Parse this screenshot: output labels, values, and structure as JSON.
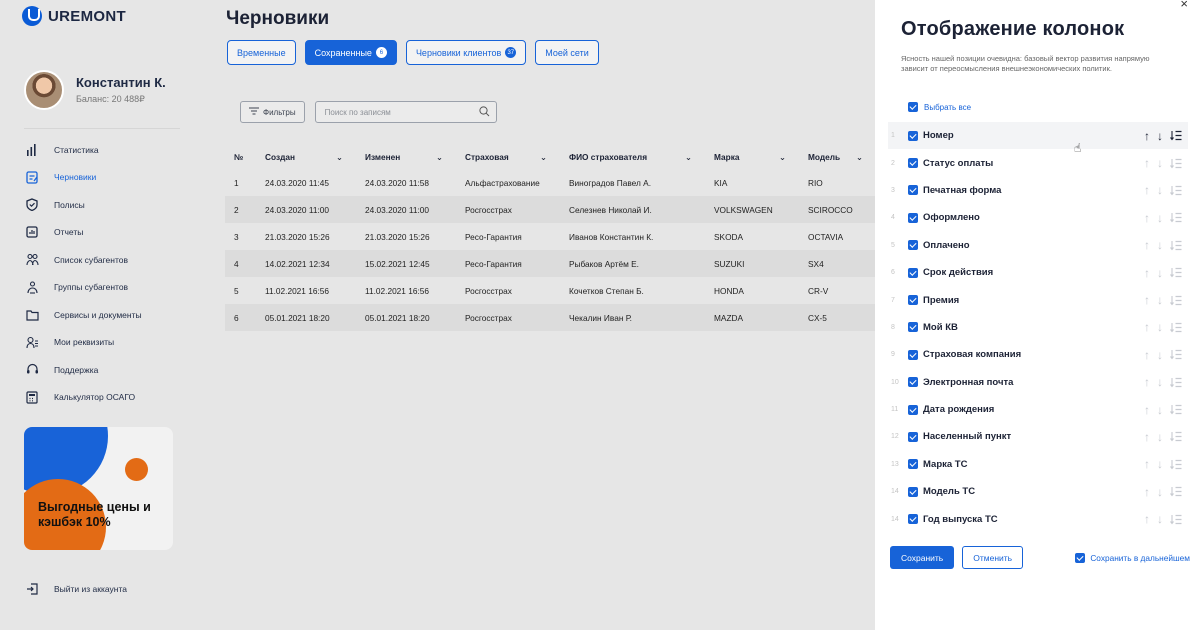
{
  "brand": {
    "name": "UREMONT"
  },
  "profile": {
    "name": "Константин К.",
    "balance": "Баланс: 20 488₽"
  },
  "nav": [
    {
      "label": "Статистика",
      "icon": "bar-chart-icon"
    },
    {
      "label": "Черновики",
      "icon": "draft-icon",
      "active": true
    },
    {
      "label": "Полисы",
      "icon": "shield-icon"
    },
    {
      "label": "Отчеты",
      "icon": "report-icon"
    },
    {
      "label": "Список субагентов",
      "icon": "users-icon"
    },
    {
      "label": "Группы субагентов",
      "icon": "group-icon"
    },
    {
      "label": "Сервисы и документы",
      "icon": "folder-icon"
    },
    {
      "label": "Мои реквизиты",
      "icon": "user-list-icon"
    },
    {
      "label": "Поддержка",
      "icon": "headset-icon"
    },
    {
      "label": "Калькулятор ОСАГО",
      "icon": "calculator-icon"
    }
  ],
  "promo": {
    "text": "Выгодные цены и кэшбэк 10%"
  },
  "logout": {
    "label": "Выйти из аккаунта"
  },
  "main": {
    "title": "Черновики",
    "tabs": [
      {
        "label": "Временные",
        "badge": ""
      },
      {
        "label": "Сохраненные",
        "badge": "6",
        "active": true
      },
      {
        "label": "Черновики клиентов",
        "badge": "37"
      },
      {
        "label": "Моей сети",
        "badge": ""
      }
    ],
    "filter_label": "Фильтры",
    "search_placeholder": "Поиск по записям"
  },
  "table": {
    "headers": [
      "№",
      "Создан",
      "Изменен",
      "Страховая",
      "ФИО страхователя",
      "Марка",
      "Модель"
    ],
    "rows": [
      [
        "1",
        "24.03.2020 11:45",
        "24.03.2020 11:58",
        "Альфастрахование",
        "Виноградов Павел А.",
        "KIA",
        "RIO"
      ],
      [
        "2",
        "24.03.2020 11:00",
        "24.03.2020 11:00",
        "Росгосстрах",
        "Селезнев Николай И.",
        "VOLKSWAGEN",
        "SCIROCCO"
      ],
      [
        "3",
        "21.03.2020 15:26",
        "21.03.2020 15:26",
        "Ресо-Гарантия",
        "Иванов Константин К.",
        "SKODA",
        "OCTAVIA"
      ],
      [
        "4",
        "14.02.2021 12:34",
        "15.02.2021 12:45",
        "Ресо-Гарантия",
        "Рыбаков Артём Е.",
        "SUZUKI",
        "SX4"
      ],
      [
        "5",
        "11.02.2021 16:56",
        "11.02.2021 16:56",
        "Росгосстрах",
        "Кочетков Степан Б.",
        "HONDA",
        "CR-V"
      ],
      [
        "6",
        "05.01.2021 18:20",
        "05.01.2021 18:20",
        "Росгосстрах",
        "Чекалин Иван Р.",
        "MAZDA",
        "CX-5"
      ]
    ]
  },
  "panel": {
    "close": "×",
    "title": "Отображение колонок",
    "description": "Ясность нашей позиции очевидна: базовый вектор развития напрямую зависит от переосмысления внешнеэкономических политик.",
    "select_all": "Выбрать все",
    "columns": [
      {
        "num": "1",
        "label": "Номер"
      },
      {
        "num": "2",
        "label": "Статус оплаты"
      },
      {
        "num": "3",
        "label": "Печатная форма"
      },
      {
        "num": "4",
        "label": "Оформлено"
      },
      {
        "num": "5",
        "label": "Оплачено"
      },
      {
        "num": "6",
        "label": "Срок действия"
      },
      {
        "num": "7",
        "label": "Премия"
      },
      {
        "num": "8",
        "label": "Мой КВ"
      },
      {
        "num": "9",
        "label": "Страховая компания"
      },
      {
        "num": "10",
        "label": "Электронная почта"
      },
      {
        "num": "11",
        "label": "Дата рождения"
      },
      {
        "num": "12",
        "label": "Населенный пункт"
      },
      {
        "num": "13",
        "label": "Марка ТС"
      },
      {
        "num": "14",
        "label": "Модель ТС"
      },
      {
        "num": "14",
        "label": "Год выпуска ТС"
      }
    ],
    "save": "Сохранить",
    "cancel": "Отменить",
    "save_future": "Сохранить в дальнейшем"
  }
}
